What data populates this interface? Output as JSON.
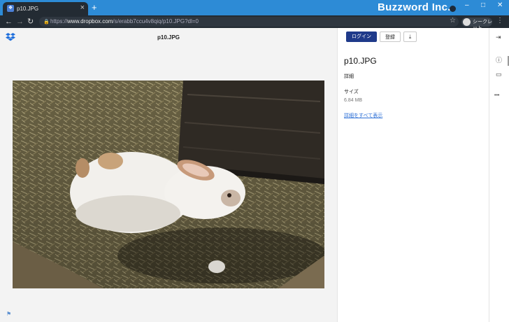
{
  "browser": {
    "tab_title": "p10.JPG",
    "tab_close": "×",
    "new_tab": "+",
    "brand": "Buzzword Inc.",
    "window_controls": {
      "minimize": "–",
      "maximize": "□",
      "close": "✕"
    },
    "nav": {
      "back": "←",
      "forward": "→",
      "reload": "↻"
    },
    "url_prefix": "https://",
    "url_domain": "www.dropbox.com",
    "url_path": "/s/erabb7ccu4v8qiq/p10.JPG?dl=0",
    "bookmark_star": "☆",
    "incognito_label": "シークレット",
    "menu": "⋮"
  },
  "viewer": {
    "file_title": "p10.JPG",
    "flag": "⚑",
    "image_alt": "rabbit photo"
  },
  "panel": {
    "login_label": "ログイン",
    "signup_label": "登録",
    "download_icon": "⤓",
    "file_name": "p10.JPG",
    "details_label": "詳細",
    "size_label": "サイズ",
    "size_value": "6.84 MB",
    "show_all_link": "詳細をすべて表示"
  },
  "rail": {
    "collapse": "⇥",
    "info": "ⓘ",
    "comment": "▭",
    "more": "•••"
  },
  "colors": {
    "titlebar": "#2d8bd6",
    "browser_dark": "#232b33",
    "login_button": "#1f3a8a",
    "link": "#2c6fd6",
    "dropbox": "#1f6fdc"
  }
}
